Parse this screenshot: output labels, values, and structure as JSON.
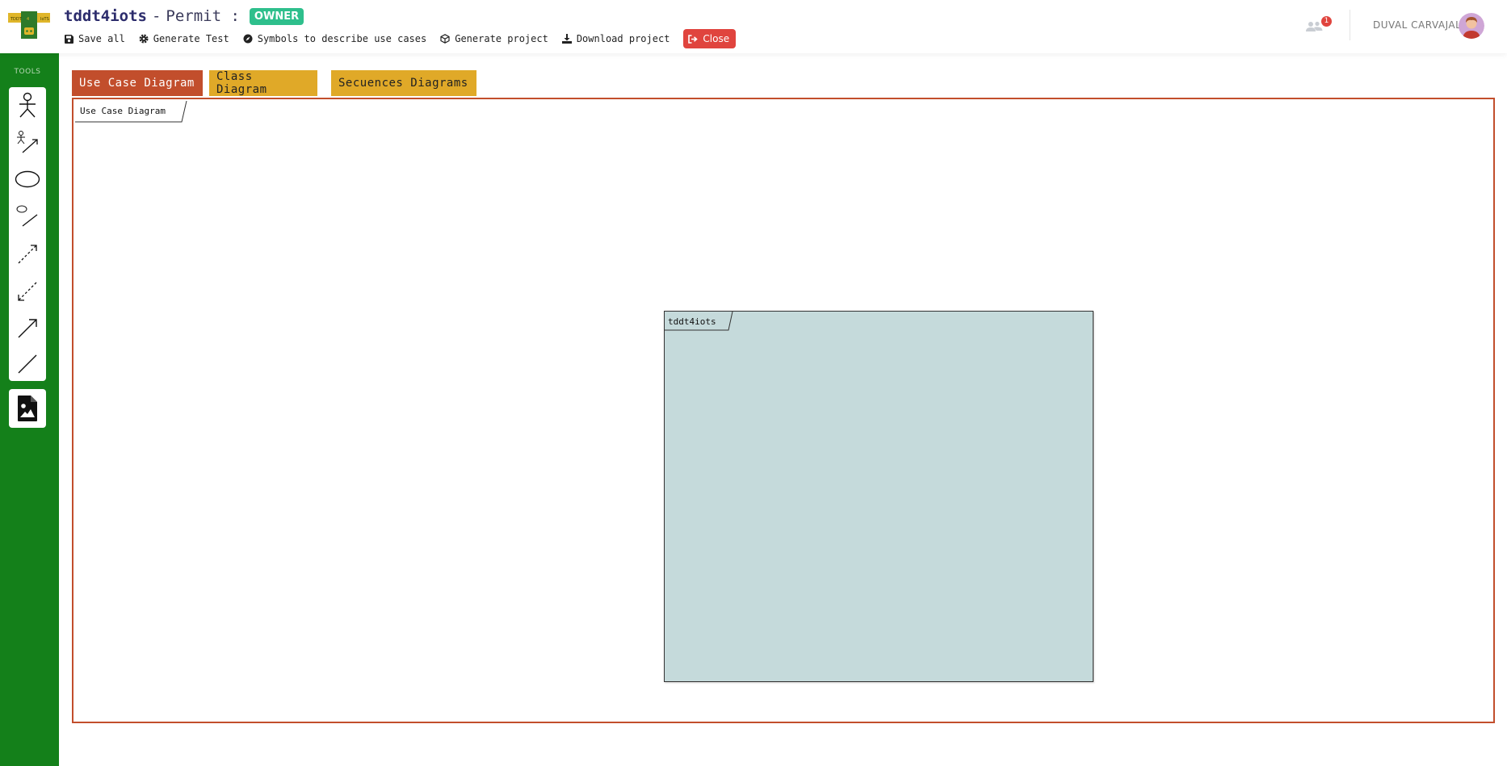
{
  "header": {
    "project_name": "tddt4iots",
    "separator": "-",
    "permit_label": "Permit :",
    "role_badge": "OWNER",
    "logo_icon": "tddt4iots-logo-icon"
  },
  "toolbar": {
    "save_all": "Save all",
    "generate_test": "Generate Test",
    "symbols": "Symbols to describe use cases",
    "generate_project": "Generate project",
    "download_project": "Download project",
    "close": "Close"
  },
  "user": {
    "notification_count": "1",
    "name": "DUVAL CARVAJAL"
  },
  "sidebar": {
    "title": "TOOLS",
    "tools": [
      {
        "icon": "actor-icon"
      },
      {
        "icon": "actor-association-icon"
      },
      {
        "icon": "use-case-ellipse-icon"
      },
      {
        "icon": "use-case-association-icon"
      },
      {
        "icon": "include-dashed-arrow-icon"
      },
      {
        "icon": "extend-dashed-arrow-icon"
      },
      {
        "icon": "generalization-arrow-icon"
      },
      {
        "icon": "association-line-icon"
      }
    ],
    "image_tool_icon": "export-image-icon"
  },
  "tabs": [
    {
      "label": "Use Case Diagram",
      "active": true
    },
    {
      "label": "Class Diagram",
      "active": false
    },
    {
      "label": "Secuences Diagrams",
      "active": false
    }
  ],
  "canvas": {
    "frame_label": "Use Case Diagram",
    "system_boundary_label": "tddt4iots"
  },
  "colors": {
    "sidebar": "#14801a",
    "tab_active": "#c24e2c",
    "tab_inactive": "#e0a928",
    "system_fill": "#c5dadb",
    "badge": "#2ebf8c",
    "close": "#e0443e"
  }
}
